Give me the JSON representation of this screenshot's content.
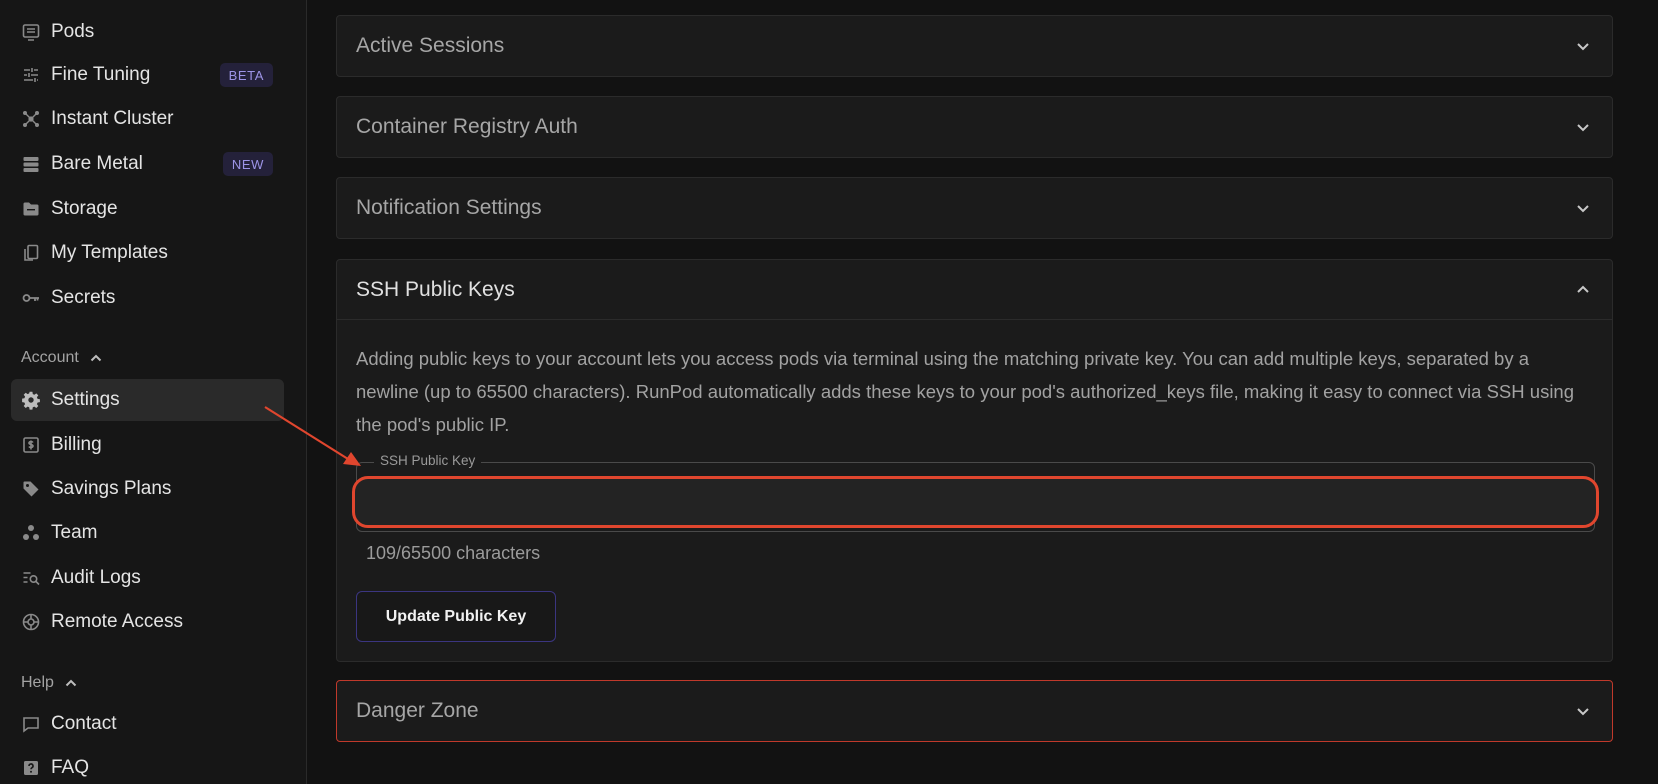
{
  "sidebar": {
    "items": [
      {
        "label": "Pods",
        "icon": "pods-icon"
      },
      {
        "label": "Fine Tuning",
        "icon": "sliders-icon",
        "badge": "BETA"
      },
      {
        "label": "Instant Cluster",
        "icon": "cluster-icon"
      },
      {
        "label": "Bare Metal",
        "icon": "server-icon",
        "badge": "NEW"
      },
      {
        "label": "Storage",
        "icon": "folder-icon"
      },
      {
        "label": "My Templates",
        "icon": "templates-icon"
      },
      {
        "label": "Secrets",
        "icon": "key-icon"
      }
    ],
    "account_label": "Account",
    "account_items": [
      {
        "label": "Settings",
        "icon": "gear-icon",
        "active": true
      },
      {
        "label": "Billing",
        "icon": "billing-icon"
      },
      {
        "label": "Savings Plans",
        "icon": "tag-icon"
      },
      {
        "label": "Team",
        "icon": "team-icon"
      },
      {
        "label": "Audit Logs",
        "icon": "audit-icon"
      },
      {
        "label": "Remote Access",
        "icon": "remote-icon"
      }
    ],
    "help_label": "Help",
    "help_items": [
      {
        "label": "Contact",
        "icon": "chat-icon"
      },
      {
        "label": "FAQ",
        "icon": "faq-icon"
      }
    ]
  },
  "panels": {
    "active_sessions": "Active Sessions",
    "container_registry": "Container Registry Auth",
    "notifications": "Notification Settings",
    "ssh": {
      "title": "SSH Public Keys",
      "description": "Adding public keys to your account lets you access pods via terminal using the matching private key. You can add multiple keys, separated by a newline (up to 65500 characters). RunPod automatically adds these keys to your pod's authorized_keys file, making it easy to connect via SSH using the pod's public IP.",
      "field_label": "SSH Public Key",
      "field_value": "",
      "char_count": "109/65500 characters",
      "button": "Update Public Key"
    },
    "danger_zone": "Danger Zone"
  },
  "colors": {
    "background": "#121212",
    "panel": "#1b1b1b",
    "badge_text": "#9d94e6",
    "highlight": "#e0462e",
    "button_border": "#3b3580"
  }
}
